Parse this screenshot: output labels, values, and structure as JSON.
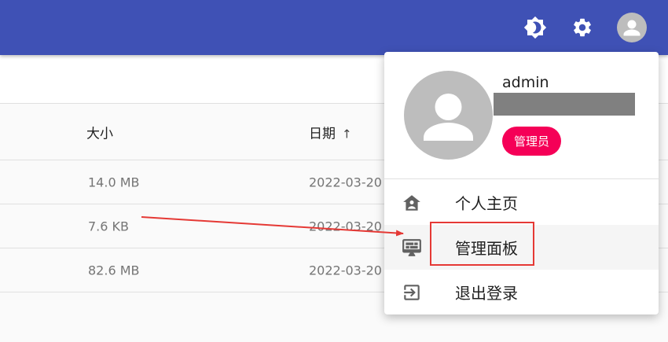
{
  "app_bar": {
    "color": "#3f51b5",
    "icons": [
      "theme-toggle-icon",
      "settings-icon",
      "account-icon"
    ]
  },
  "table": {
    "headers": {
      "size": "大小",
      "date": "日期",
      "sort_indicator": "↑"
    },
    "rows": [
      {
        "size": "14.0 MB",
        "date": "2022-03-20"
      },
      {
        "size": "7.6 KB",
        "date": "2022-03-20"
      },
      {
        "size": "82.6 MB",
        "date": "2022-03-20"
      }
    ]
  },
  "user_menu": {
    "username": "admin",
    "role": "管理员",
    "items": [
      {
        "label": "个人主页",
        "icon": "profile-home-icon"
      },
      {
        "label": "管理面板",
        "icon": "admin-dashboard-icon"
      },
      {
        "label": "退出登录",
        "icon": "logout-icon"
      }
    ]
  },
  "colors": {
    "role_chip": "#f50057",
    "annotation": "#e53935"
  }
}
